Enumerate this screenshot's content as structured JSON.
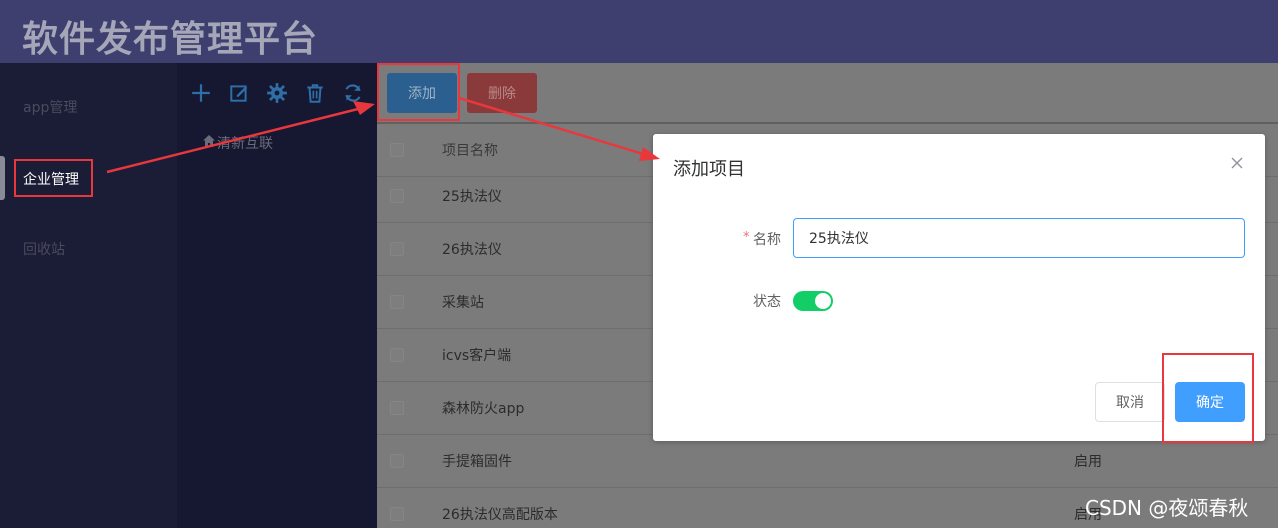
{
  "header": {
    "title": "软件发布管理平台"
  },
  "sidebar": {
    "items": [
      {
        "label": "app管理"
      },
      {
        "label": "企业管理"
      },
      {
        "label": "回收站"
      }
    ]
  },
  "tree": {
    "toolbar_icons": [
      "plus-icon",
      "edit-icon",
      "gear-icon",
      "trash-icon",
      "refresh-icon"
    ],
    "nodes": [
      {
        "label": "清新互联",
        "icon": "home-icon"
      }
    ]
  },
  "toolbar": {
    "add_label": "添加",
    "delete_label": "删除"
  },
  "table": {
    "columns": [
      "项目名称"
    ],
    "rows": [
      {
        "name": "25执法仪",
        "status": ""
      },
      {
        "name": "26执法仪",
        "status": ""
      },
      {
        "name": "采集站",
        "status": ""
      },
      {
        "name": "icvs客户端",
        "status": ""
      },
      {
        "name": "森林防火app",
        "status": ""
      },
      {
        "name": "手提箱固件",
        "status": "启用"
      },
      {
        "name": "26执法仪高配版本",
        "status": "启用"
      }
    ]
  },
  "dialog": {
    "title": "添加项目",
    "required_mark": "*",
    "name_label": "名称",
    "name_value": "25执法仪",
    "status_label": "状态",
    "status_on": true,
    "cancel_label": "取消",
    "confirm_label": "确定"
  },
  "colors": {
    "header_bg": "#3e3f6f",
    "sidebar_bg": "#1b1c35",
    "primary": "#409eff",
    "switch_on": "#13ce66",
    "annotation": "#e8373d"
  },
  "watermark": "CSDN @夜颂春秋"
}
